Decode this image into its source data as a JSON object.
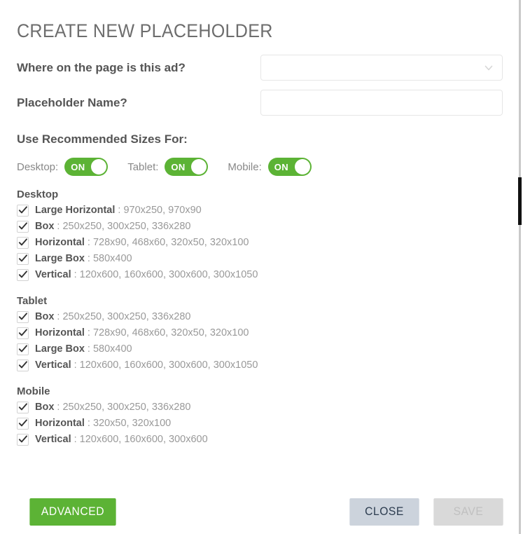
{
  "header": {
    "title": "CREATE NEW PLACEHOLDER"
  },
  "form": {
    "location": {
      "label": "Where on the page is this ad?",
      "value": "",
      "placeholder": "",
      "icon": "chevron-down-icon"
    },
    "name": {
      "label": "Placeholder Name?",
      "value": "",
      "placeholder": ""
    }
  },
  "recommended": {
    "heading": "Use Recommended Sizes For:",
    "toggles": [
      {
        "label": "Desktop:",
        "state": "ON"
      },
      {
        "label": "Tablet:",
        "state": "ON"
      },
      {
        "label": "Mobile:",
        "state": "ON"
      }
    ]
  },
  "size_groups": [
    {
      "title": "Desktop",
      "items": [
        {
          "name": "Large Horizontal",
          "sep": ":",
          "values": "970x250, 970x90",
          "checked": true
        },
        {
          "name": "Box",
          "sep": ":",
          "values": "250x250, 300x250, 336x280",
          "checked": true
        },
        {
          "name": "Horizontal",
          "sep": ":",
          "values": "728x90, 468x60, 320x50, 320x100",
          "checked": true
        },
        {
          "name": "Large Box",
          "sep": ":",
          "values": "580x400",
          "checked": true
        },
        {
          "name": "Vertical",
          "sep": ":",
          "values": "120x600, 160x600, 300x600, 300x1050",
          "checked": true
        }
      ]
    },
    {
      "title": "Tablet",
      "items": [
        {
          "name": "Box",
          "sep": ":",
          "values": "250x250, 300x250, 336x280",
          "checked": true
        },
        {
          "name": "Horizontal",
          "sep": ":",
          "values": "728x90, 468x60, 320x50, 320x100",
          "checked": true
        },
        {
          "name": "Large Box",
          "sep": ":",
          "values": "580x400",
          "checked": true
        },
        {
          "name": "Vertical",
          "sep": ":",
          "values": "120x600, 160x600, 300x600, 300x1050",
          "checked": true
        }
      ]
    },
    {
      "title": "Mobile",
      "items": [
        {
          "name": "Box",
          "sep": ":",
          "values": "250x250, 300x250, 336x280",
          "checked": true
        },
        {
          "name": "Horizontal",
          "sep": ":",
          "values": "320x50, 320x100",
          "checked": true
        },
        {
          "name": "Vertical",
          "sep": ":",
          "values": "120x600, 160x600, 300x600",
          "checked": true
        }
      ]
    }
  ],
  "footer": {
    "advanced_label": "ADVANCED",
    "close_label": "CLOSE",
    "save_label": "SAVE"
  },
  "colors": {
    "green": "#5cb335",
    "close_bg": "#ccd3dc",
    "save_bg": "#d9d9d9",
    "text": "#555555",
    "muted": "#999999"
  }
}
